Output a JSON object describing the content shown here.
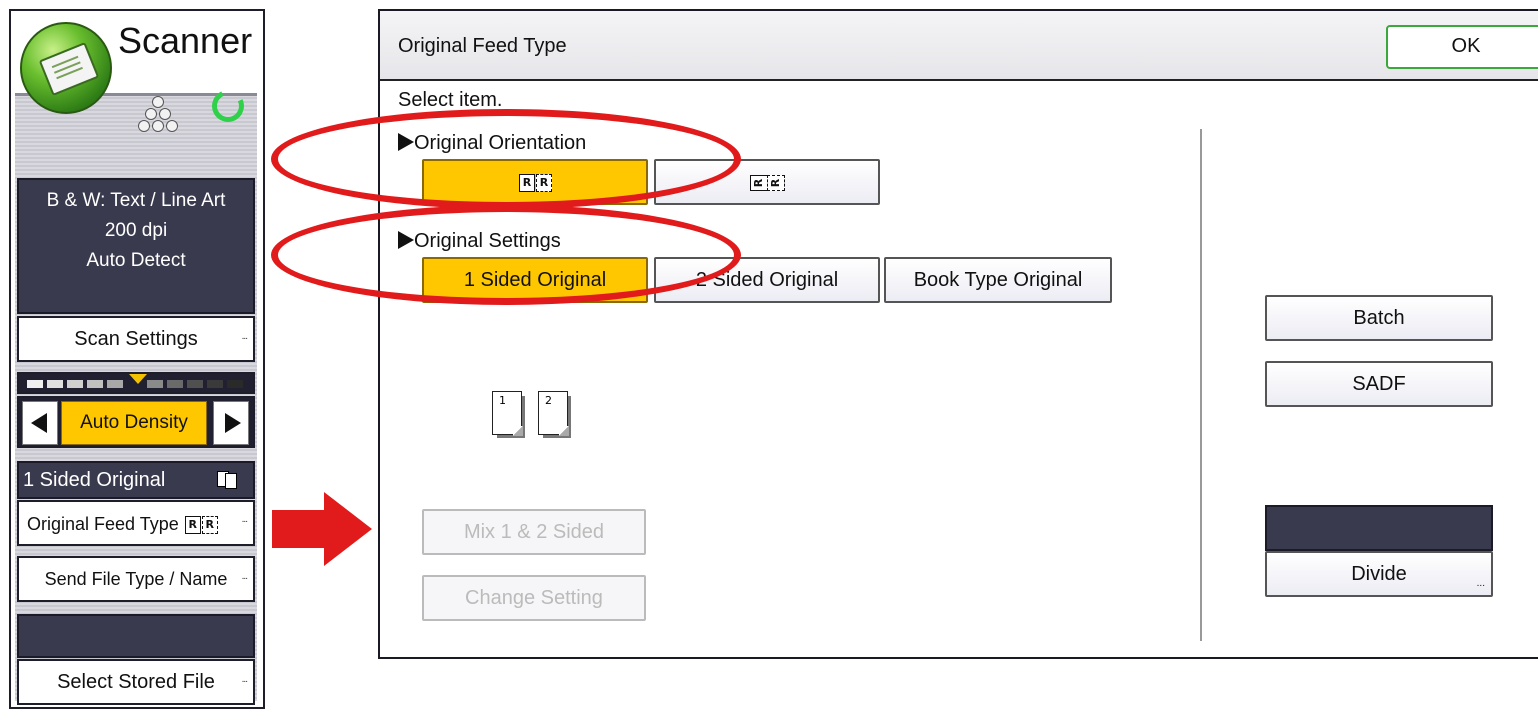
{
  "scanner_panel": {
    "title": "Scanner",
    "settings_display": [
      "B & W: Text / Line Art",
      "200 dpi",
      "Auto Detect"
    ],
    "scan_settings_label": "Scan Settings",
    "density_label": "Auto Density",
    "sided_info": "1 Sided Original",
    "original_feed_type_label": "Original Feed Type",
    "send_file_type_label": "Send File Type / Name",
    "select_stored_file_label": "Select Stored File"
  },
  "dialog": {
    "title": "Original Feed Type",
    "ok_label": "OK",
    "select_item_label": "Select item.",
    "orientation_label": "Original Orientation",
    "settings_label": "Original Settings",
    "settings_options": [
      "1 Sided Original",
      "2 Sided Original",
      "Book Type Original"
    ],
    "selected_setting": "1 Sided Original",
    "orientation_icon_glyph": "R",
    "page_numbers": [
      "1",
      "2"
    ],
    "mix_label": "Mix 1 & 2 Sided",
    "change_setting_label": "Change Setting",
    "batch_label": "Batch",
    "sadf_label": "SADF",
    "divide_label": "Divide"
  },
  "colors": {
    "selected_yellow": "#ffc700",
    "highlight_red": "#e11b1b",
    "ok_border_green": "#3aa83a",
    "progress_green": "#2fd04a",
    "dark_panel": "#3a3a4e"
  }
}
